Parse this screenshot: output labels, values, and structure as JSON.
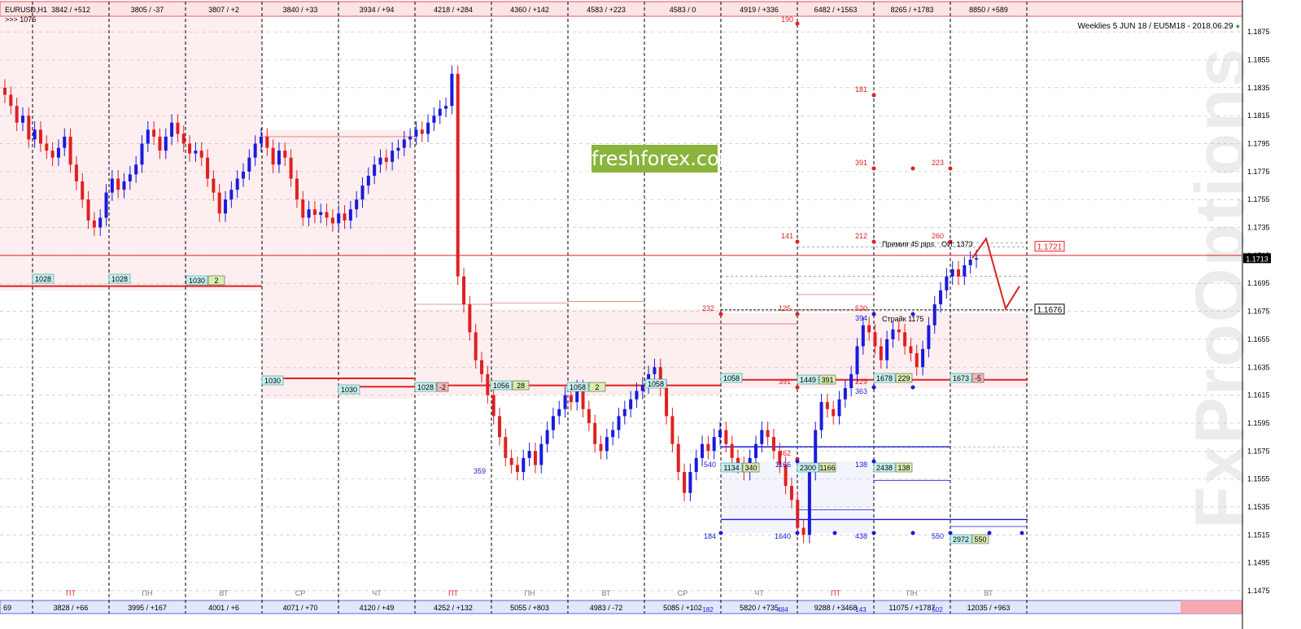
{
  "chart_info": {
    "symbol": "EURUSD,H1",
    "sub": ">>> 1076",
    "title": "Weeklies 5 JUN 18 / EU5M18 - 2018.06.29",
    "brand": "freshforex.com",
    "watermark": "FxProOptions"
  },
  "colors": {
    "up": "#1a1adc",
    "down": "#e02020",
    "level": "#e02020",
    "panel": "#fde9ec",
    "grid": "#000000"
  },
  "chart_data": {
    "type": "candlestick",
    "ylim": [
      1.1468,
      1.1885
    ],
    "yticks": [
      "1.1875",
      "1.1855",
      "1.1835",
      "1.1815",
      "1.1795",
      "1.1775",
      "1.1755",
      "1.1735",
      "1.1715",
      "1.1695",
      "1.1675",
      "1.1655",
      "1.1635",
      "1.1615",
      "1.1595",
      "1.1575",
      "1.1555",
      "1.1535",
      "1.1515",
      "1.1495",
      "1.1475"
    ],
    "price_current": "1.1713",
    "price_labels": [
      {
        "label": "1.1721",
        "value": 1.1721,
        "color": "red"
      },
      {
        "label": "1.1676",
        "value": 1.1676,
        "color": "black"
      }
    ],
    "top_row": [
      "3842 / +512",
      "3805 / -37",
      "3807 / +2",
      "3840 / +33",
      "3934 / +94",
      "4218 / +284",
      "4360 / +142",
      "4583 / +223",
      "4583 / 0",
      "4919 / +336",
      "6482 / +1563",
      "8265 / +1783",
      "8850 / +589"
    ],
    "bottom_row": [
      "69",
      "3828 / +66",
      "3995 / +167",
      "4001 / +6",
      "4071 / +70",
      "4120 / +49",
      "4252 / +132",
      "5055 / +803",
      "4983 / -72",
      "5085 / +102",
      "5820 / +735",
      "9288 / +3468",
      "11075 / +1787",
      "12035 / +963"
    ],
    "days": [
      "ПТ",
      "ПН",
      "ВТ",
      "СР",
      "ЧТ",
      "ПТ",
      "ПН",
      "ВТ",
      "СР",
      "ЧТ",
      "ПТ",
      "ПН",
      "ВТ"
    ],
    "day_colors": [
      "red",
      "gray",
      "gray",
      "gray",
      "gray",
      "red",
      "gray",
      "gray",
      "gray",
      "gray",
      "red",
      "gray",
      "gray"
    ],
    "bottom_small": [
      "182",
      "484",
      "143",
      "502"
    ],
    "levels_boxes": [
      {
        "text": "1028"
      },
      {
        "text": "1028"
      },
      {
        "text": "1030",
        "tag": "2"
      },
      {
        "text": "1030"
      },
      {
        "text": "1030"
      },
      {
        "text": "1028",
        "tag": "-2"
      },
      {
        "text": "1056",
        "tag": "28"
      },
      {
        "text": "1058",
        "tag": "2"
      },
      {
        "text": "1058"
      },
      {
        "text": "1058"
      },
      {
        "text": "1449",
        "tag": "391"
      },
      {
        "text": "1678",
        "tag": "229"
      },
      {
        "text": "1673",
        "tag": "-5"
      },
      {
        "text": "1134",
        "tag": "340"
      },
      {
        "text": "2300",
        "tag": "1166"
      },
      {
        "text": "2438",
        "tag": "138"
      },
      {
        "text": "2972",
        "tag": "550"
      }
    ],
    "point_labels_red": [
      "190",
      "181",
      "391",
      "223",
      "141",
      "212",
      "260",
      "232",
      "125",
      "530",
      "391",
      "229",
      "462"
    ],
    "point_labels_blue": [
      "394",
      "363",
      "359",
      "540",
      "1166",
      "138",
      "184",
      "1640",
      "438",
      "550"
    ],
    "annotations": [
      "Премия 45 pips",
      "ОИ: 1373",
      "Страйк 1175"
    ],
    "series": [
      {
        "closes": [
          1.183,
          1.1822,
          1.181,
          1.1815,
          1.1798,
          1.1805,
          1.1795,
          1.179,
          1.1785,
          1.1792,
          1.18,
          1.178,
          1.1768,
          1.1755,
          1.174,
          1.1735,
          1.1742,
          1.176,
          1.177,
          1.1762,
          1.1768,
          1.1773,
          1.178,
          1.1795,
          1.1805,
          1.18,
          1.179,
          1.18,
          1.181,
          1.1802,
          1.1795,
          1.1788,
          1.179,
          1.1785,
          1.177,
          1.176,
          1.1745,
          1.1755,
          1.1762,
          1.177,
          1.1775,
          1.1785,
          1.1795,
          1.18,
          1.1792,
          1.178,
          1.179,
          1.1785,
          1.177,
          1.1755,
          1.1742,
          1.1748,
          1.1744,
          1.1746,
          1.1742,
          1.1738,
          1.1745,
          1.174,
          1.1748,
          1.1755,
          1.1765,
          1.1772,
          1.178,
          1.1785,
          1.1782,
          1.179,
          1.1792,
          1.1798,
          1.18,
          1.1805,
          1.1802,
          1.181,
          1.1815,
          1.182,
          1.1822,
          1.1845,
          1.17,
          1.168,
          1.166,
          1.164,
          1.163,
          1.1615,
          1.16,
          1.1585,
          1.157,
          1.1565,
          1.156,
          1.157,
          1.1575,
          1.1565,
          1.158,
          1.159,
          1.16,
          1.1605,
          1.1615,
          1.161,
          1.162,
          1.1605,
          1.1595,
          1.158,
          1.1575,
          1.1585,
          1.159,
          1.16,
          1.1605,
          1.1612,
          1.1618,
          1.1622,
          1.163,
          1.1635,
          1.162,
          1.16,
          1.158,
          1.156,
          1.1545,
          1.156,
          1.157,
          1.158,
          1.1575,
          1.1585,
          1.159,
          1.158,
          1.157,
          1.1565,
          1.156,
          1.157,
          1.158,
          1.159,
          1.1585,
          1.1575,
          1.1565,
          1.155,
          1.154,
          1.152,
          1.1515,
          1.156,
          1.159,
          1.161,
          1.1605,
          1.16,
          1.1612,
          1.162,
          1.163,
          1.165,
          1.1665,
          1.166,
          1.165,
          1.164,
          1.1655,
          1.1662,
          1.166,
          1.165,
          1.1645,
          1.1635,
          1.1648,
          1.1665,
          1.168,
          1.169,
          1.17,
          1.1705,
          1.17,
          1.1708,
          1.1712,
          1.1713
        ]
      }
    ]
  }
}
